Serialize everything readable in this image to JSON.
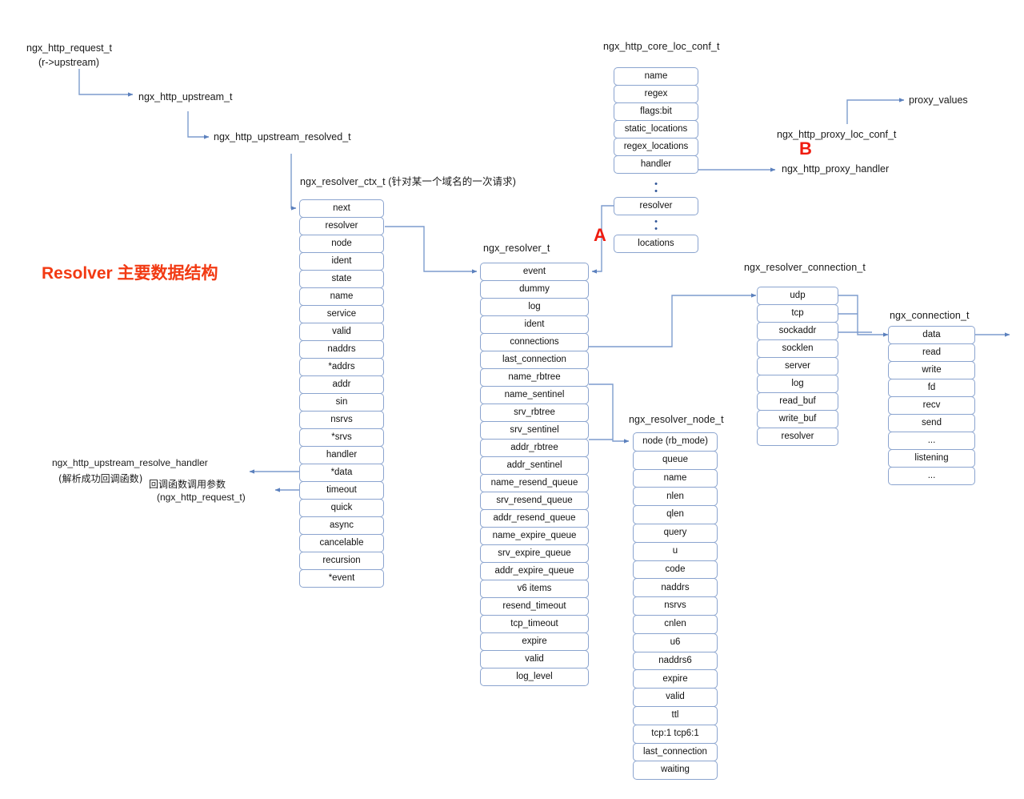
{
  "title": {
    "text": "Resolver 主要数据结构",
    "color": "#f23a13"
  },
  "colors": {
    "box_border": "#8ba4cf",
    "wire": "#7d9ccd",
    "marker_red": "#ef1c10",
    "text": "#1a1a1a"
  },
  "labels": {
    "ngx_http_request_t": "ngx_http_request_t",
    "ngx_http_request_t_sub": "(r->upstream)",
    "ngx_http_upstream_t": "ngx_http_upstream_t",
    "ngx_http_upstream_resolved_t": "ngx_http_upstream_resolved_t",
    "resolve_handler": "ngx_http_upstream_resolve_handler",
    "resolve_handler_sub": "(解析成功回调函数)",
    "callback_param": "回调函数调用参数",
    "callback_param_sub": "(ngx_http_request_t)",
    "proxy_values": "proxy_values",
    "ngx_http_proxy_loc_conf_t": "ngx_http_proxy_loc_conf_t",
    "ngx_http_proxy_handler": "ngx_http_proxy_handler",
    "marker_a": "A",
    "marker_b": "B"
  },
  "structs": [
    {
      "id": "ngx_resolver_ctx_t",
      "title": "ngx_resolver_ctx_t (针对某一个域名的一次请求)",
      "fields": [
        "next",
        "resolver",
        "node",
        "ident",
        "state",
        "name",
        "service",
        "valid",
        "naddrs",
        "*addrs",
        "addr",
        "sin",
        "nsrvs",
        "*srvs",
        "handler",
        "*data",
        "timeout",
        "quick",
        "async",
        "cancelable",
        "recursion",
        "*event"
      ]
    },
    {
      "id": "ngx_http_core_loc_conf_t",
      "title": "ngx_http_core_loc_conf_t",
      "fields": [
        "name",
        "regex",
        "flags:bit",
        "static_locations",
        "regex_locations",
        "handler"
      ],
      "fields_after_dots": [
        "resolver"
      ],
      "fields_after_dots2": [
        "locations"
      ]
    },
    {
      "id": "ngx_resolver_t",
      "title": "ngx_resolver_t",
      "fields": [
        "event",
        "dummy",
        "log",
        "ident",
        "connections",
        "last_connection",
        "name_rbtree",
        "name_sentinel",
        "srv_rbtree",
        "srv_sentinel",
        "addr_rbtree",
        "addr_sentinel",
        "name_resend_queue",
        "srv_resend_queue",
        "addr_resend_queue",
        "name_expire_queue",
        "srv_expire_queue",
        "addr_expire_queue",
        "v6 items",
        "resend_timeout",
        "tcp_timeout",
        "expire",
        "valid",
        "log_level"
      ]
    },
    {
      "id": "ngx_resolver_node_t",
      "title": "ngx_resolver_node_t",
      "fields": [
        "node (rb_mode)",
        "queue",
        "name",
        "nlen",
        "qlen",
        "query",
        "u",
        "code",
        "naddrs",
        "nsrvs",
        "cnlen",
        "u6",
        "naddrs6",
        "expire",
        "valid",
        "ttl",
        "tcp:1 tcp6:1",
        "last_connection",
        "waiting"
      ]
    },
    {
      "id": "ngx_resolver_connection_t",
      "title": "ngx_resolver_connection_t",
      "fields": [
        "udp",
        "tcp",
        "sockaddr",
        "socklen",
        "server",
        "log",
        "read_buf",
        "write_buf",
        "resolver"
      ]
    },
    {
      "id": "ngx_connection_t",
      "title": "ngx_connection_t",
      "fields": [
        "data",
        "read",
        "write",
        "fd",
        "recv",
        "send",
        "...",
        "listening",
        "..."
      ]
    }
  ]
}
